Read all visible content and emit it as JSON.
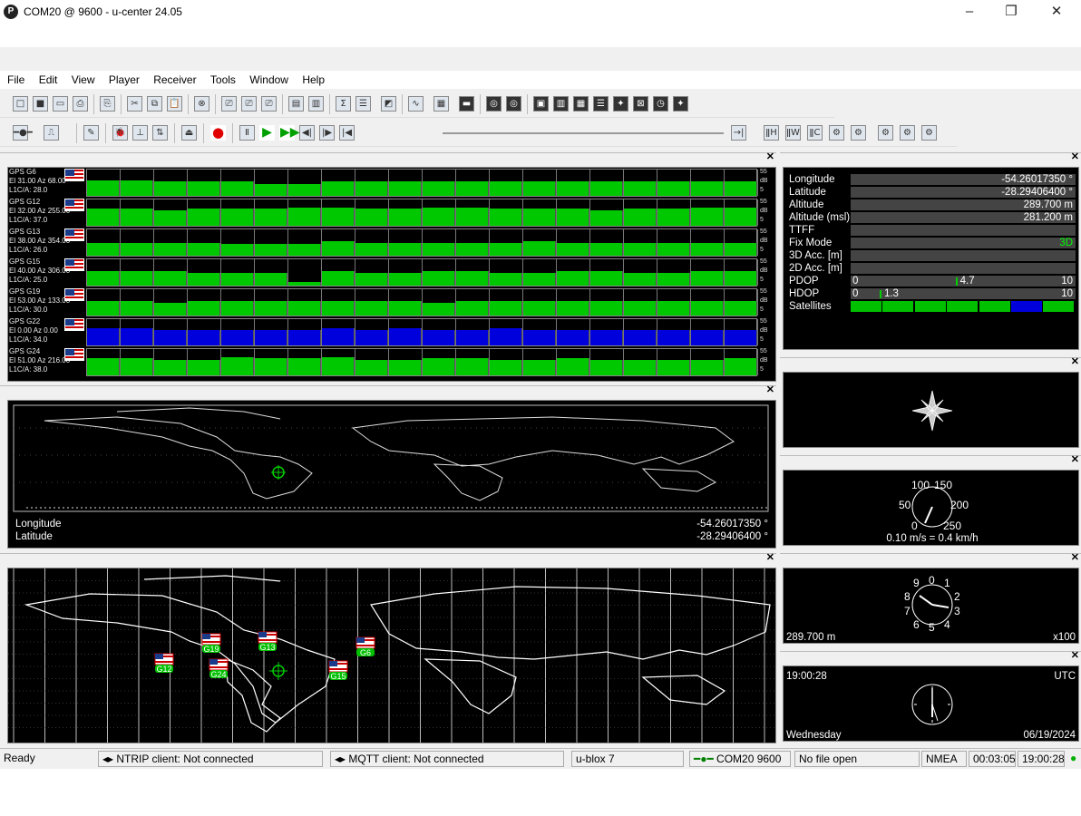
{
  "window": {
    "title": "COM20 @ 9600 - u-center 24.05",
    "logo": "P"
  },
  "menu": [
    "File",
    "Edit",
    "View",
    "Player",
    "Receiver",
    "Tools",
    "Window",
    "Help"
  ],
  "satellites": [
    {
      "name": "GPS G6",
      "elaz": "El 31.00 Az 68.00",
      "l1": "L1C/A: 28.0",
      "color": "#00c800",
      "levels": [
        0.6,
        0.6,
        0.55,
        0.55,
        0.55,
        0.45,
        0.45,
        0.55,
        0.55,
        0.55,
        0.55,
        0.55,
        0.55,
        0.55,
        0.55,
        0.55,
        0.55,
        0.55,
        0.55,
        0.55
      ]
    },
    {
      "name": "GPS G12",
      "elaz": "El 32.00 Az 255.00",
      "l1": "L1C/A: 37.0",
      "color": "#00c800",
      "levels": [
        0.65,
        0.65,
        0.6,
        0.65,
        0.65,
        0.65,
        0.7,
        0.7,
        0.65,
        0.65,
        0.7,
        0.7,
        0.65,
        0.65,
        0.65,
        0.6,
        0.65,
        0.65,
        0.7,
        0.7
      ]
    },
    {
      "name": "GPS G13",
      "elaz": "El 38.00 Az 354.00",
      "l1": "L1C/A: 26.0",
      "color": "#00c800",
      "levels": [
        0.5,
        0.5,
        0.5,
        0.5,
        0.45,
        0.45,
        0.45,
        0.55,
        0.5,
        0.5,
        0.5,
        0.5,
        0.5,
        0.55,
        0.5,
        0.5,
        0.5,
        0.5,
        0.5,
        0.5
      ]
    },
    {
      "name": "GPS G15",
      "elaz": "El 40.00 Az 306.00",
      "l1": "L1C/A: 25.0",
      "color": "#00c800",
      "levels": [
        0.55,
        0.55,
        0.55,
        0.5,
        0.5,
        0.5,
        0.15,
        0.55,
        0.5,
        0.5,
        0.55,
        0.55,
        0.5,
        0.5,
        0.55,
        0.55,
        0.5,
        0.5,
        0.55,
        0.55
      ]
    },
    {
      "name": "GPS G19",
      "elaz": "El 53.00 Az 133.00",
      "l1": "L1C/A: 30.0",
      "color": "#00c800",
      "levels": [
        0.55,
        0.55,
        0.5,
        0.55,
        0.55,
        0.55,
        0.55,
        0.55,
        0.55,
        0.55,
        0.5,
        0.55,
        0.55,
        0.55,
        0.55,
        0.55,
        0.55,
        0.55,
        0.55,
        0.55
      ]
    },
    {
      "name": "GPS G22",
      "elaz": "El 0.00 Az 0.00",
      "l1": "L1C/A: 34.0",
      "color": "#0000dc",
      "levels": [
        0.65,
        0.65,
        0.6,
        0.6,
        0.6,
        0.6,
        0.6,
        0.65,
        0.6,
        0.65,
        0.6,
        0.6,
        0.65,
        0.6,
        0.6,
        0.6,
        0.6,
        0.6,
        0.6,
        0.6
      ]
    },
    {
      "name": "GPS G24",
      "elaz": "El 51.00 Az 216.00",
      "l1": "L1C/A: 38.0",
      "color": "#00c800",
      "levels": [
        0.65,
        0.65,
        0.6,
        0.6,
        0.7,
        0.65,
        0.65,
        0.7,
        0.6,
        0.6,
        0.65,
        0.65,
        0.6,
        0.6,
        0.65,
        0.6,
        0.6,
        0.6,
        0.6,
        0.65
      ]
    }
  ],
  "scale": {
    "max": "55",
    "unit": "dB",
    "min": "5"
  },
  "map": {
    "lon_label": "Longitude",
    "lat_label": "Latitude",
    "lon": "-54.26017350 °",
    "lat": "-28.29406400 °"
  },
  "skyview_labels": [
    {
      "id": "G12"
    },
    {
      "id": "G19"
    },
    {
      "id": "G24"
    },
    {
      "id": "G13"
    },
    {
      "id": "G15"
    },
    {
      "id": "G6"
    }
  ],
  "info": {
    "rows": [
      {
        "label": "Longitude",
        "value": "-54.26017350 °"
      },
      {
        "label": "Latitude",
        "value": "-28.29406400 °"
      },
      {
        "label": "Altitude",
        "value": "289.700 m"
      },
      {
        "label": "Altitude (msl)",
        "value": "281.200 m"
      },
      {
        "label": "TTFF",
        "value": ""
      },
      {
        "label": "Fix Mode",
        "value": "3D"
      },
      {
        "label": "3D Acc. [m]",
        "value": ""
      },
      {
        "label": "2D Acc. [m]",
        "value": ""
      }
    ],
    "pdop": {
      "label": "PDOP",
      "min": "0",
      "value": "4.7",
      "max": "10"
    },
    "hdop": {
      "label": "HDOP",
      "min": "0",
      "value": "1.3",
      "max": "10"
    },
    "satellites_label": "Satellites",
    "fix_color": "#00ff00"
  },
  "speed": {
    "t100": "100",
    "t150": "150",
    "t50": "50",
    "t200": "200",
    "t0": "0",
    "t250": "250",
    "readout": "0.10 m/s = 0.4 km/h"
  },
  "altimeter": {
    "d9": "9",
    "d0": "0",
    "d1": "1",
    "d8": "8",
    "d2": "2",
    "d7": "7",
    "d3": "3",
    "d6": "6",
    "d5": "5",
    "d4": "4",
    "value": "289.700 m",
    "scale": "x100"
  },
  "clock": {
    "time": "19:00:28",
    "zone": "UTC",
    "day": "Wednesday",
    "date": "06/19/2024"
  },
  "status": {
    "ready": "Ready",
    "ntrip": "NTRIP client: Not connected",
    "mqtt": "MQTT client: Not connected",
    "receiver": "u-blox 7",
    "port": "COM20 9600",
    "file": "No file open",
    "protocol": "NMEA",
    "elapsed": "00:03:05",
    "clock": "19:00:28"
  }
}
